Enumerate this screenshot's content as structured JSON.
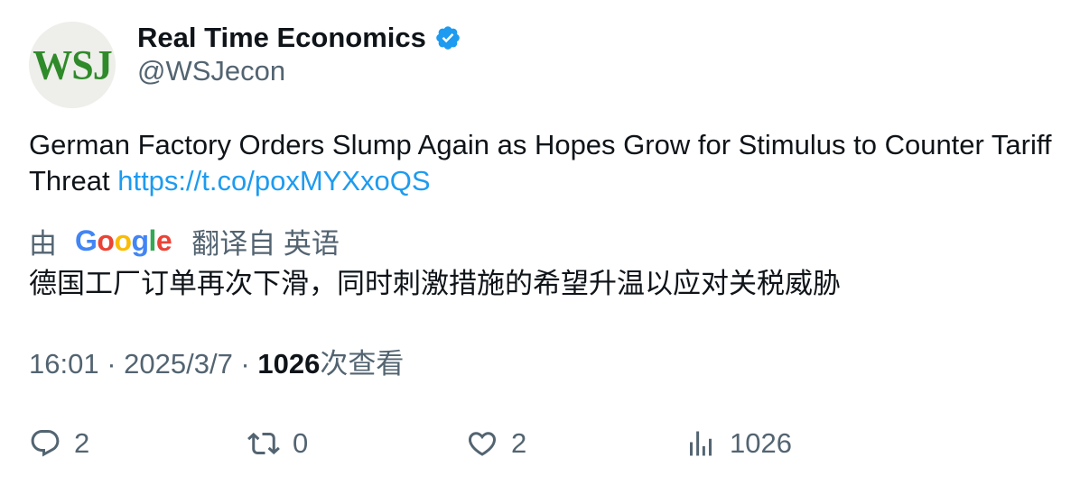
{
  "account": {
    "display_name": "Real Time Economics",
    "handle": "@WSJecon",
    "avatar_text": "WSJ",
    "verified": true
  },
  "tweet": {
    "text": "German Factory Orders Slump Again as Hopes Grow for Stimulus to Counter Tariff Threat ",
    "link": "https://t.co/poxMYXxoQS"
  },
  "translation": {
    "prefix": "由",
    "provider": "Google",
    "suffix": "翻译自 英语",
    "text": "德国工厂订单再次下滑，同时刺激措施的希望升温以应对关税威胁"
  },
  "meta": {
    "time": "16:01",
    "separator": " · ",
    "date": "2025/3/7",
    "views_count": "1026",
    "views_label": "次查看"
  },
  "actions": {
    "reply_count": "2",
    "retweet_count": "0",
    "like_count": "2",
    "views_count": "1026"
  },
  "colors": {
    "link": "#1d9bf0",
    "muted": "#536471",
    "text": "#0f1419",
    "verified": "#1d9bf0",
    "avatar_logo": "#2f8a2a"
  },
  "icons": [
    "verified-badge-icon",
    "reply-icon",
    "retweet-icon",
    "like-icon",
    "views-icon"
  ]
}
